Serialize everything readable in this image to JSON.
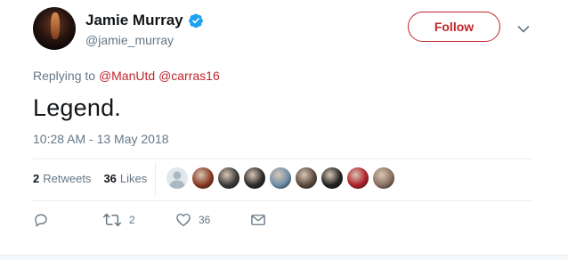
{
  "author": {
    "display_name": "Jamie Murray",
    "handle": "@jamie_murray",
    "verified": true
  },
  "follow_button": {
    "label": "Follow"
  },
  "reply_context": {
    "prefix": "Replying to",
    "mentions": [
      "@ManUtd",
      "@carras16"
    ]
  },
  "tweet": {
    "text": "Legend.",
    "timestamp": "10:28 AM - 13 May 2018"
  },
  "stats": {
    "retweets_count": "2",
    "retweets_label": "Retweets",
    "likes_count": "36",
    "likes_label": "Likes"
  },
  "likers": [
    {
      "name": "default-avatar",
      "color": "#aab8c2"
    },
    {
      "name": "liker-2",
      "color": "#8a3a22"
    },
    {
      "name": "liker-3",
      "color": "#3a3a3a"
    },
    {
      "name": "liker-4",
      "color": "#2a2a2a"
    },
    {
      "name": "liker-5",
      "color": "#6c8fa8"
    },
    {
      "name": "liker-6",
      "color": "#5a4a3e"
    },
    {
      "name": "liker-7",
      "color": "#222222"
    },
    {
      "name": "liker-8",
      "color": "#b0202a"
    },
    {
      "name": "liker-9",
      "color": "#8a7060"
    }
  ],
  "actions": {
    "reply_icon": "reply-icon",
    "retweet_icon": "retweet-icon",
    "retweet_count": "2",
    "like_icon": "heart-icon",
    "like_count": "36",
    "dm_icon": "envelope-icon"
  },
  "colors": {
    "accent": "#c0262c",
    "verified": "#1da1f2",
    "muted": "#657786",
    "text": "#14171a"
  }
}
